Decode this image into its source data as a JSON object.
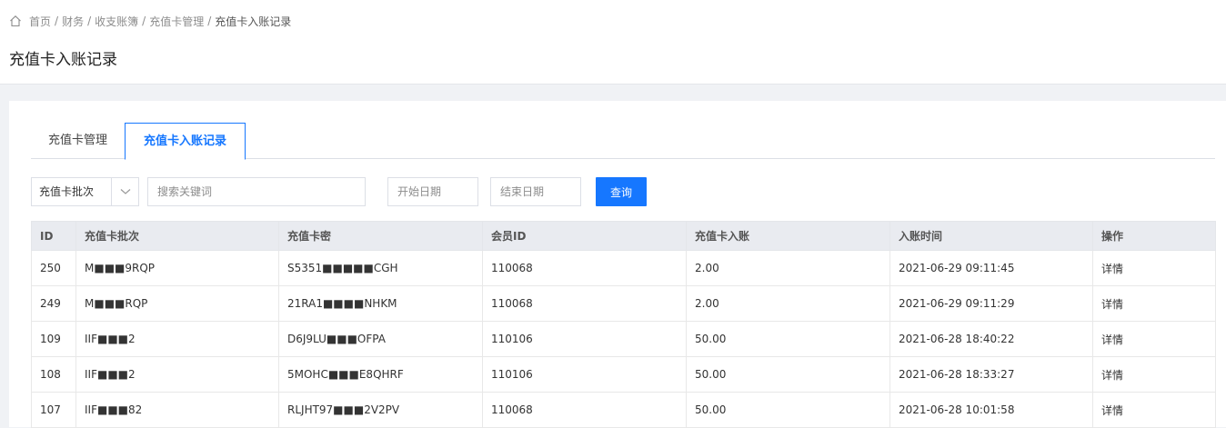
{
  "breadcrumb": [
    "首页",
    "财务",
    "收支账簿",
    "充值卡管理",
    "充值卡入账记录"
  ],
  "page_title": "充值卡入账记录",
  "tabs": [
    {
      "label": "充值卡管理",
      "active": false
    },
    {
      "label": "充值卡入账记录",
      "active": true
    }
  ],
  "filters": {
    "batch_select": "充值卡批次",
    "keyword_placeholder": "搜索关键词",
    "start_placeholder": "开始日期",
    "end_placeholder": "结束日期",
    "search_button": "查询"
  },
  "table": {
    "headers": [
      "ID",
      "充值卡批次",
      "充值卡密",
      "会员ID",
      "充值卡入账",
      "入账时间",
      "操作"
    ],
    "rows": [
      {
        "id": "250",
        "batch": "M■■■9RQP",
        "card": "S5351■■■■■CGH",
        "member": "110068",
        "amount": "2.00",
        "time": "2021-06-29 09:11:45",
        "action": "详情"
      },
      {
        "id": "249",
        "batch": "M■■■RQP",
        "card": "21RA1■■■■NHKM",
        "member": "110068",
        "amount": "2.00",
        "time": "2021-06-29 09:11:29",
        "action": "详情"
      },
      {
        "id": "109",
        "batch": "IIF■■■2",
        "card": "D6J9LU■■■OFPA",
        "member": "110106",
        "amount": "50.00",
        "time": "2021-06-28 18:40:22",
        "action": "详情"
      },
      {
        "id": "108",
        "batch": "IIF■■■2",
        "card": "5MOHC■■■E8QHRF",
        "member": "110106",
        "amount": "50.00",
        "time": "2021-06-28 18:33:27",
        "action": "详情"
      },
      {
        "id": "107",
        "batch": "IIF■■■82",
        "card": "RLJHT97■■■2V2PV",
        "member": "110068",
        "amount": "50.00",
        "time": "2021-06-28 10:01:58",
        "action": "详情"
      }
    ]
  },
  "colors": {
    "accent": "#1677ff",
    "header_bg": "#e9ebf0",
    "page_bg": "#f0f2f5"
  }
}
